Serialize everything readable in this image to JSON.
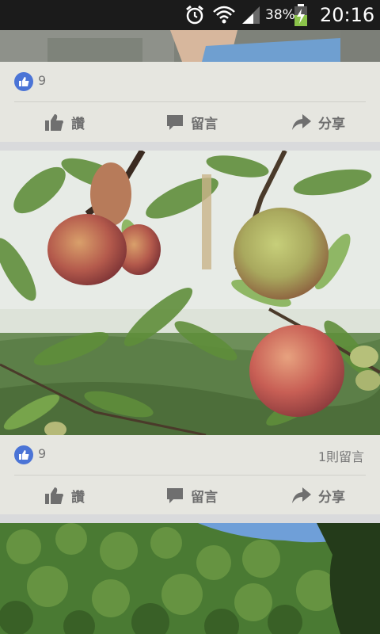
{
  "status_bar": {
    "battery_percent": "38%",
    "clock": "20:16"
  },
  "posts": [
    {
      "like_count": "9",
      "comment_count": "",
      "actions": {
        "like": "讚",
        "comment": "留言",
        "share": "分享"
      }
    },
    {
      "like_count": "9",
      "comment_count": "1則留言",
      "actions": {
        "like": "讚",
        "comment": "留言",
        "share": "分享"
      }
    }
  ],
  "colors": {
    "status_bar_bg": "#1b1b1b",
    "card_bg": "#e6e6e0",
    "like_badge": "#4b74d6",
    "action_text": "#6f6f6f",
    "battery_charge": "#8bc34a"
  }
}
